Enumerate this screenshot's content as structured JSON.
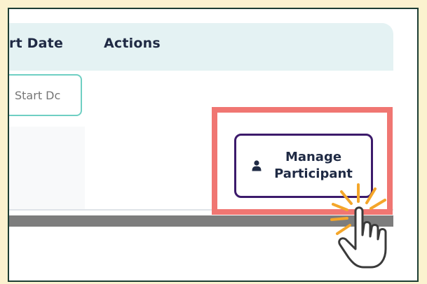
{
  "table": {
    "columns": [
      "rt Date",
      "Actions"
    ],
    "start_date_placeholder": "Start Dc"
  },
  "action_button": {
    "label": "Manage Participant",
    "icon": "person-icon"
  },
  "colors": {
    "highlight": "#f07672",
    "button_border": "#3c1a6b",
    "header_bg": "#e4f2f3",
    "input_border": "#6fcfc3",
    "page_bg": "#fbf2cf"
  }
}
